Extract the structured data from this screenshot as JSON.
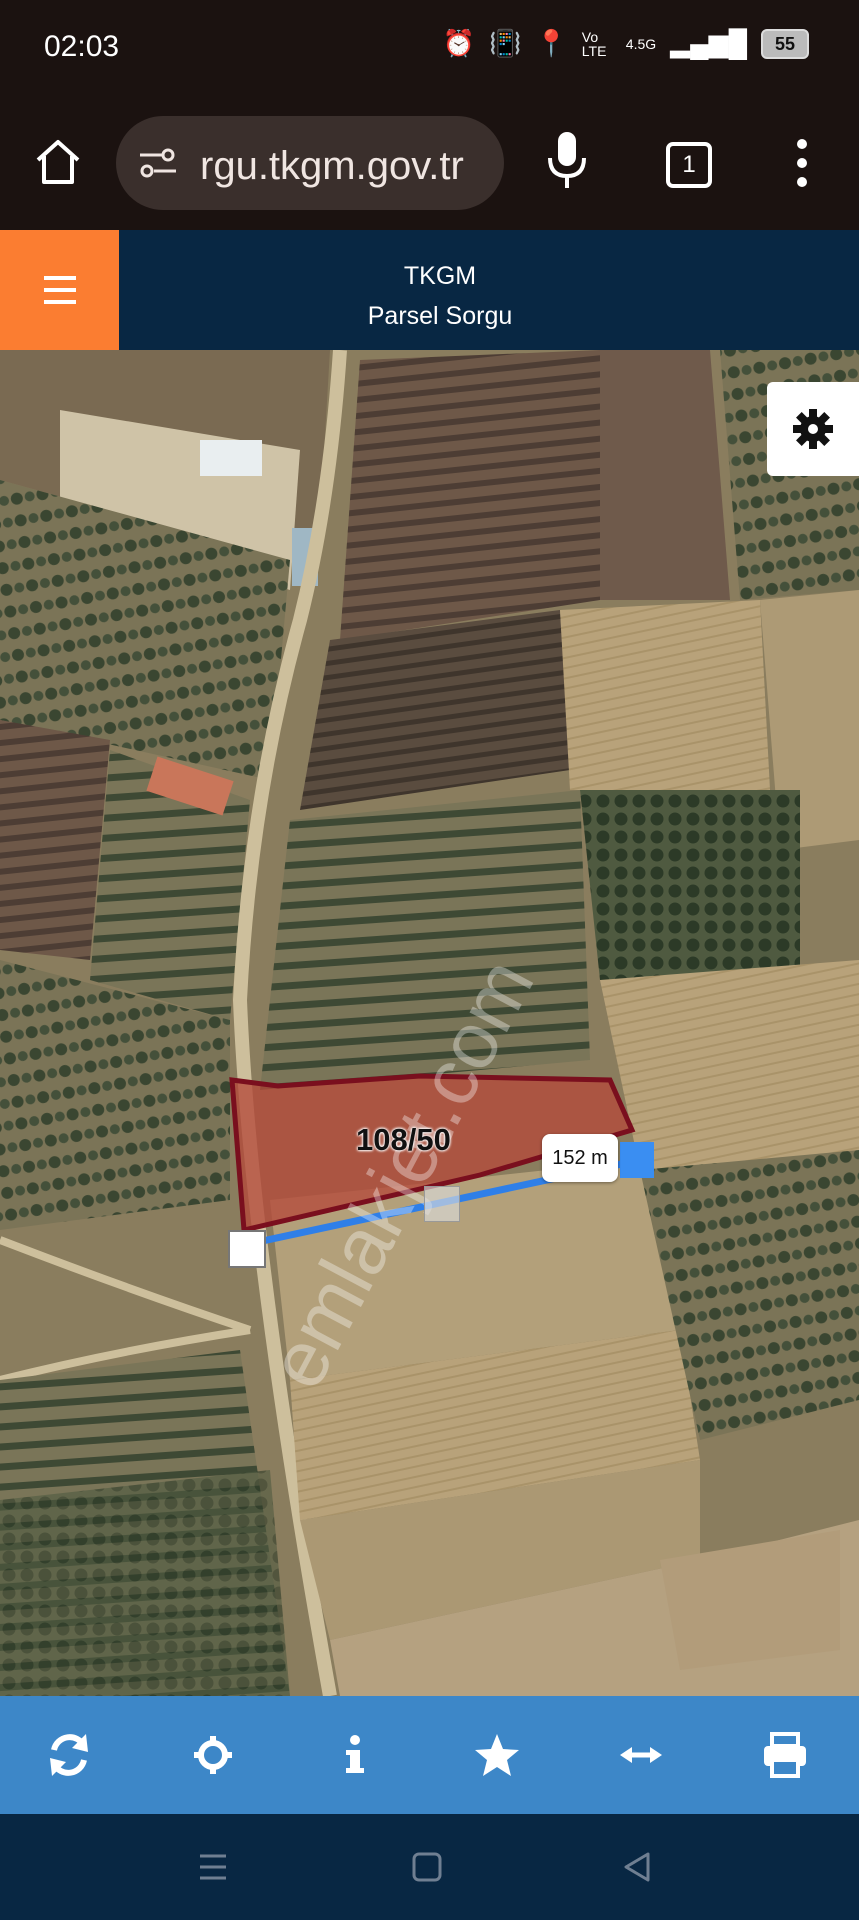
{
  "status_bar": {
    "time": "02:03",
    "network": "4.5G",
    "volte": "Vo LTE",
    "battery": "55"
  },
  "browser": {
    "url": "rgu.tkgm.gov.tr",
    "tab_count": "1"
  },
  "header": {
    "title": "TKGM",
    "subtitle": "Parsel Sorgu"
  },
  "map": {
    "parcel_label": "108/50",
    "measure_label": "152 m",
    "watermark": "emlakjet.com"
  },
  "toolbar": {
    "buttons": [
      "refresh-icon",
      "crosshair-icon",
      "info-icon",
      "star-icon",
      "measure-icon",
      "print-icon"
    ]
  },
  "colors": {
    "accent": "#fb7d31",
    "header": "#082743",
    "toolbar": "#3d87c8",
    "parcel_border": "#7a0f1e",
    "measure_line": "#2f7fe8"
  }
}
